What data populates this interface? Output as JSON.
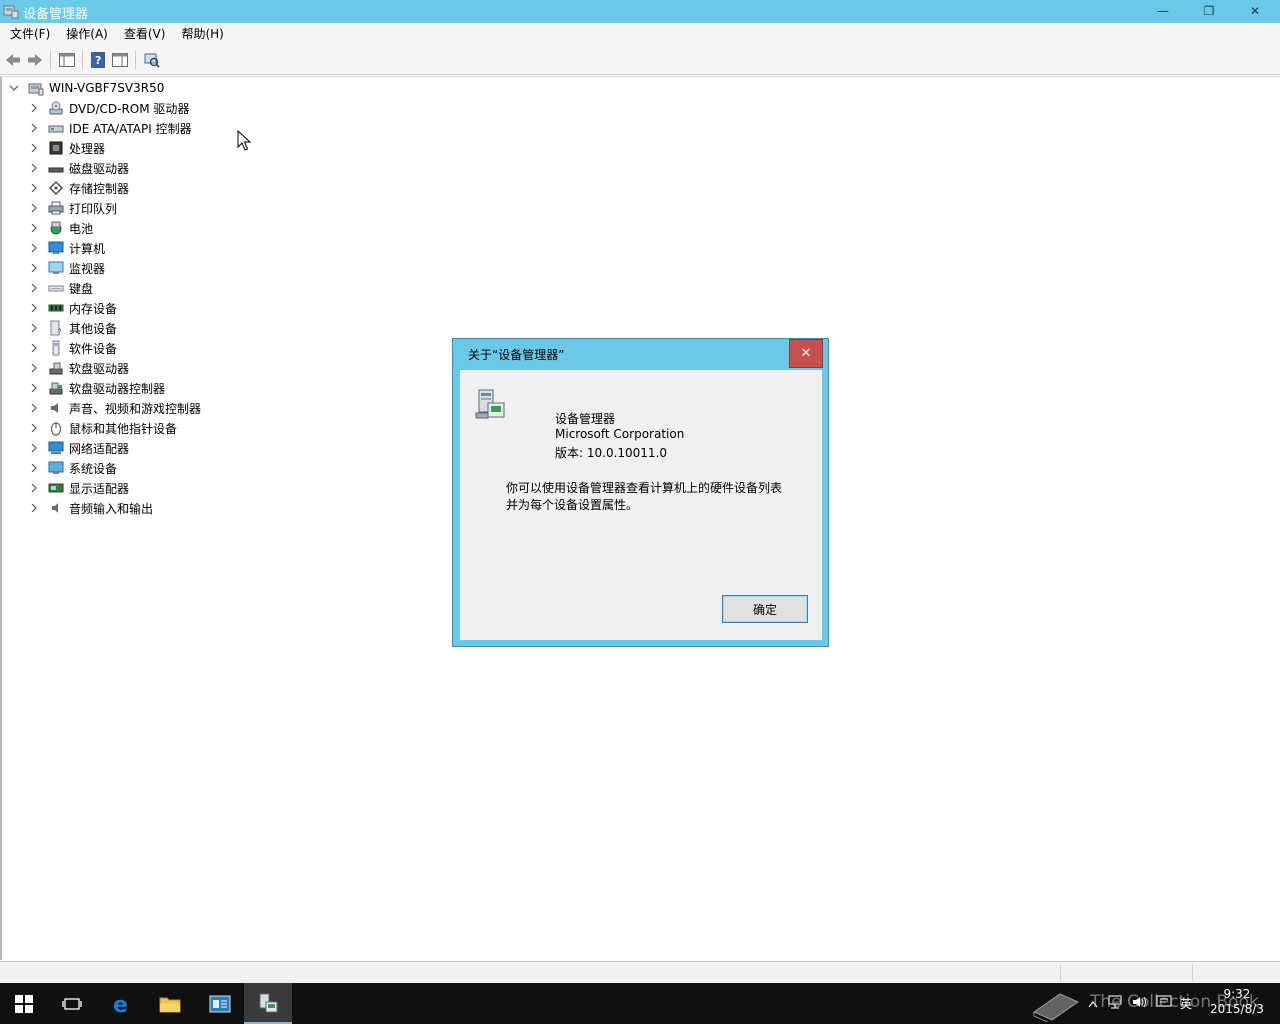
{
  "window": {
    "title": "设备管理器",
    "minimize_glyph": "—",
    "restore_glyph": "❐",
    "close_glyph": "✕"
  },
  "menu": [
    {
      "label": "文件(F)"
    },
    {
      "label": "操作(A)"
    },
    {
      "label": "查看(V)"
    },
    {
      "label": "帮助(H)"
    }
  ],
  "toolbar": {
    "icons": [
      "back-arrow-icon",
      "forward-arrow-icon",
      "show-hide-console-tree-icon",
      "help-icon",
      "properties-pane-icon",
      "scan-hardware-icon"
    ]
  },
  "tree": {
    "root": "WIN-VGBF7SV3R50",
    "items": [
      {
        "label": "DVD/CD-ROM 驱动器",
        "icon": "dvd-drive-icon"
      },
      {
        "label": "IDE ATA/ATAPI 控制器",
        "icon": "ide-controller-icon"
      },
      {
        "label": "处理器",
        "icon": "processor-icon"
      },
      {
        "label": "磁盘驱动器",
        "icon": "disk-drive-icon"
      },
      {
        "label": "存储控制器",
        "icon": "storage-controller-icon"
      },
      {
        "label": "打印队列",
        "icon": "print-queue-icon"
      },
      {
        "label": "电池",
        "icon": "battery-icon"
      },
      {
        "label": "计算机",
        "icon": "computer-icon"
      },
      {
        "label": "监视器",
        "icon": "monitor-icon"
      },
      {
        "label": "键盘",
        "icon": "keyboard-icon"
      },
      {
        "label": "内存设备",
        "icon": "memory-icon"
      },
      {
        "label": "其他设备",
        "icon": "other-devices-icon"
      },
      {
        "label": "软件设备",
        "icon": "software-device-icon"
      },
      {
        "label": "软盘驱动器",
        "icon": "floppy-drive-icon"
      },
      {
        "label": "软盘驱动器控制器",
        "icon": "floppy-controller-icon"
      },
      {
        "label": "声音、视频和游戏控制器",
        "icon": "sound-icon"
      },
      {
        "label": "鼠标和其他指针设备",
        "icon": "mouse-icon"
      },
      {
        "label": "网络适配器",
        "icon": "network-adapter-icon"
      },
      {
        "label": "系统设备",
        "icon": "system-device-icon"
      },
      {
        "label": "显示适配器",
        "icon": "display-adapter-icon"
      },
      {
        "label": "音频输入和输出",
        "icon": "audio-io-icon"
      }
    ]
  },
  "dialog": {
    "title": "关于“设备管理器”",
    "close_glyph": "✕",
    "app_name": "设备管理器",
    "company": "Microsoft Corporation",
    "version": "版本: 10.0.10011.0",
    "description_line1": "你可以使用设备管理器查看计算机上的硬件设备列表",
    "description_line2": "并为每个设备设置属性。",
    "ok_label": "确定"
  },
  "taskbar": {
    "tray_language": "英",
    "clock_time": "9:32",
    "clock_date": "2015/8/3",
    "watermark": "The Collection Book"
  },
  "colors": {
    "titlebar": "#6ac8e8",
    "dialog_close": "#c75050",
    "taskbar": "#101010"
  }
}
